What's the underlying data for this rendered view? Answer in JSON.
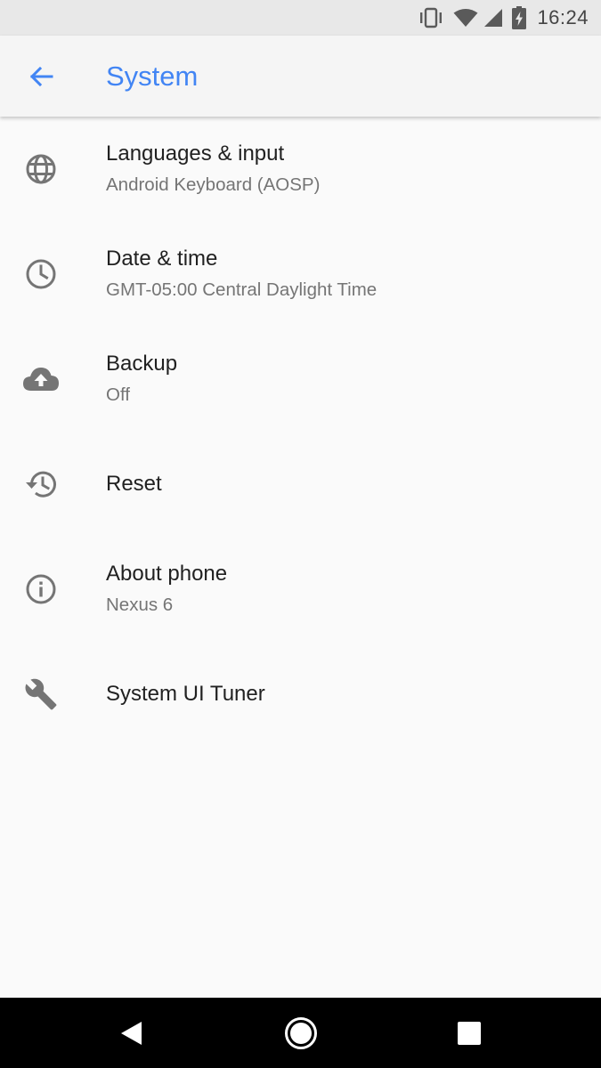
{
  "status_bar": {
    "time": "16:24",
    "icons": [
      "vibrate-icon",
      "wifi-icon",
      "cell-signal-icon",
      "battery-charging-icon"
    ]
  },
  "app_bar": {
    "title": "System",
    "back_icon": "arrow-back-icon"
  },
  "settings": [
    {
      "icon": "globe-icon",
      "title": "Languages & input",
      "summary": "Android Keyboard (AOSP)"
    },
    {
      "icon": "clock-icon",
      "title": "Date & time",
      "summary": "GMT-05:00 Central Daylight Time"
    },
    {
      "icon": "cloud-upload-icon",
      "title": "Backup",
      "summary": "Off"
    },
    {
      "icon": "history-icon",
      "title": "Reset",
      "summary": ""
    },
    {
      "icon": "info-icon",
      "title": "About phone",
      "summary": "Nexus 6"
    },
    {
      "icon": "wrench-icon",
      "title": "System UI Tuner",
      "summary": ""
    }
  ],
  "nav_bar": {
    "icons": [
      "nav-back-icon",
      "nav-home-icon",
      "nav-recents-icon"
    ]
  },
  "colors": {
    "accent": "#4285f4",
    "background": "#fafafa",
    "status_bar": "#e8e8e8",
    "app_bar": "#f5f5f5",
    "primary_text": "#212121",
    "secondary_text": "#757575",
    "icon": "#757575",
    "nav_bar": "#000000"
  }
}
